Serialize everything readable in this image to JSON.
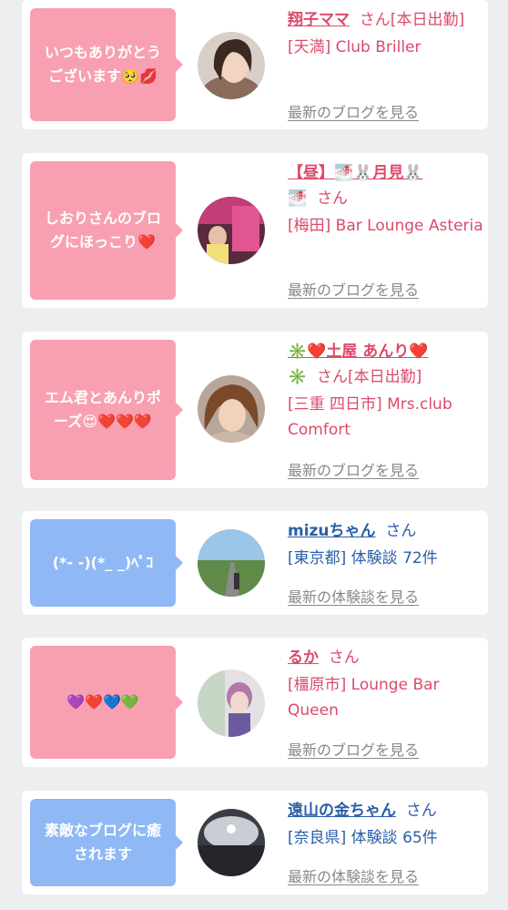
{
  "items": [
    {
      "message": "いつもありがとうございます🥺💋",
      "message_color": "pink",
      "name": "翔子ママ",
      "suffix": "さん[本日出勤]",
      "area": "[天満] Club Briller",
      "link": "最新のブログを見る",
      "name_color": "pink"
    },
    {
      "message": "しおりさんのブログにほっこり❤️",
      "message_color": "pink",
      "name": "【昼】🌁🐰月見🐰",
      "name2": "🌁",
      "suffix": "さん",
      "area": "[梅田] Bar Lounge Asteria",
      "link": "最新のブログを見る",
      "name_color": "pink"
    },
    {
      "message": "エム君とあんりポーズ😍❤️❤️❤️",
      "message_color": "pink",
      "name": "✳️❤️土屋 あんり❤️",
      "name2": "✳️",
      "suffix": "さん[本日出勤]",
      "area": "[三重 四日市] Mrs.club Comfort",
      "link": "最新のブログを見る",
      "name_color": "pink"
    },
    {
      "message": "(*- -)(*_ _)ﾍﾟｺ",
      "message_color": "blue",
      "name": "mizuちゃん",
      "suffix": "さん",
      "area": "[東京都] 体験談 72件",
      "link": "最新の体験談を見る",
      "name_color": "blue"
    },
    {
      "message": "💜❤️💙💚",
      "message_color": "pink",
      "name": "るか",
      "suffix": "さん",
      "area": "[橿原市] Lounge Bar Queen",
      "link": "最新のブログを見る",
      "name_color": "pink"
    },
    {
      "message": "素敵なブログに癒されます",
      "message_color": "blue",
      "name": "遠山の金ちゃん",
      "suffix": "さん",
      "area": "[奈良県] 体験談 65件",
      "link": "最新の体験談を見る",
      "name_color": "blue"
    }
  ]
}
